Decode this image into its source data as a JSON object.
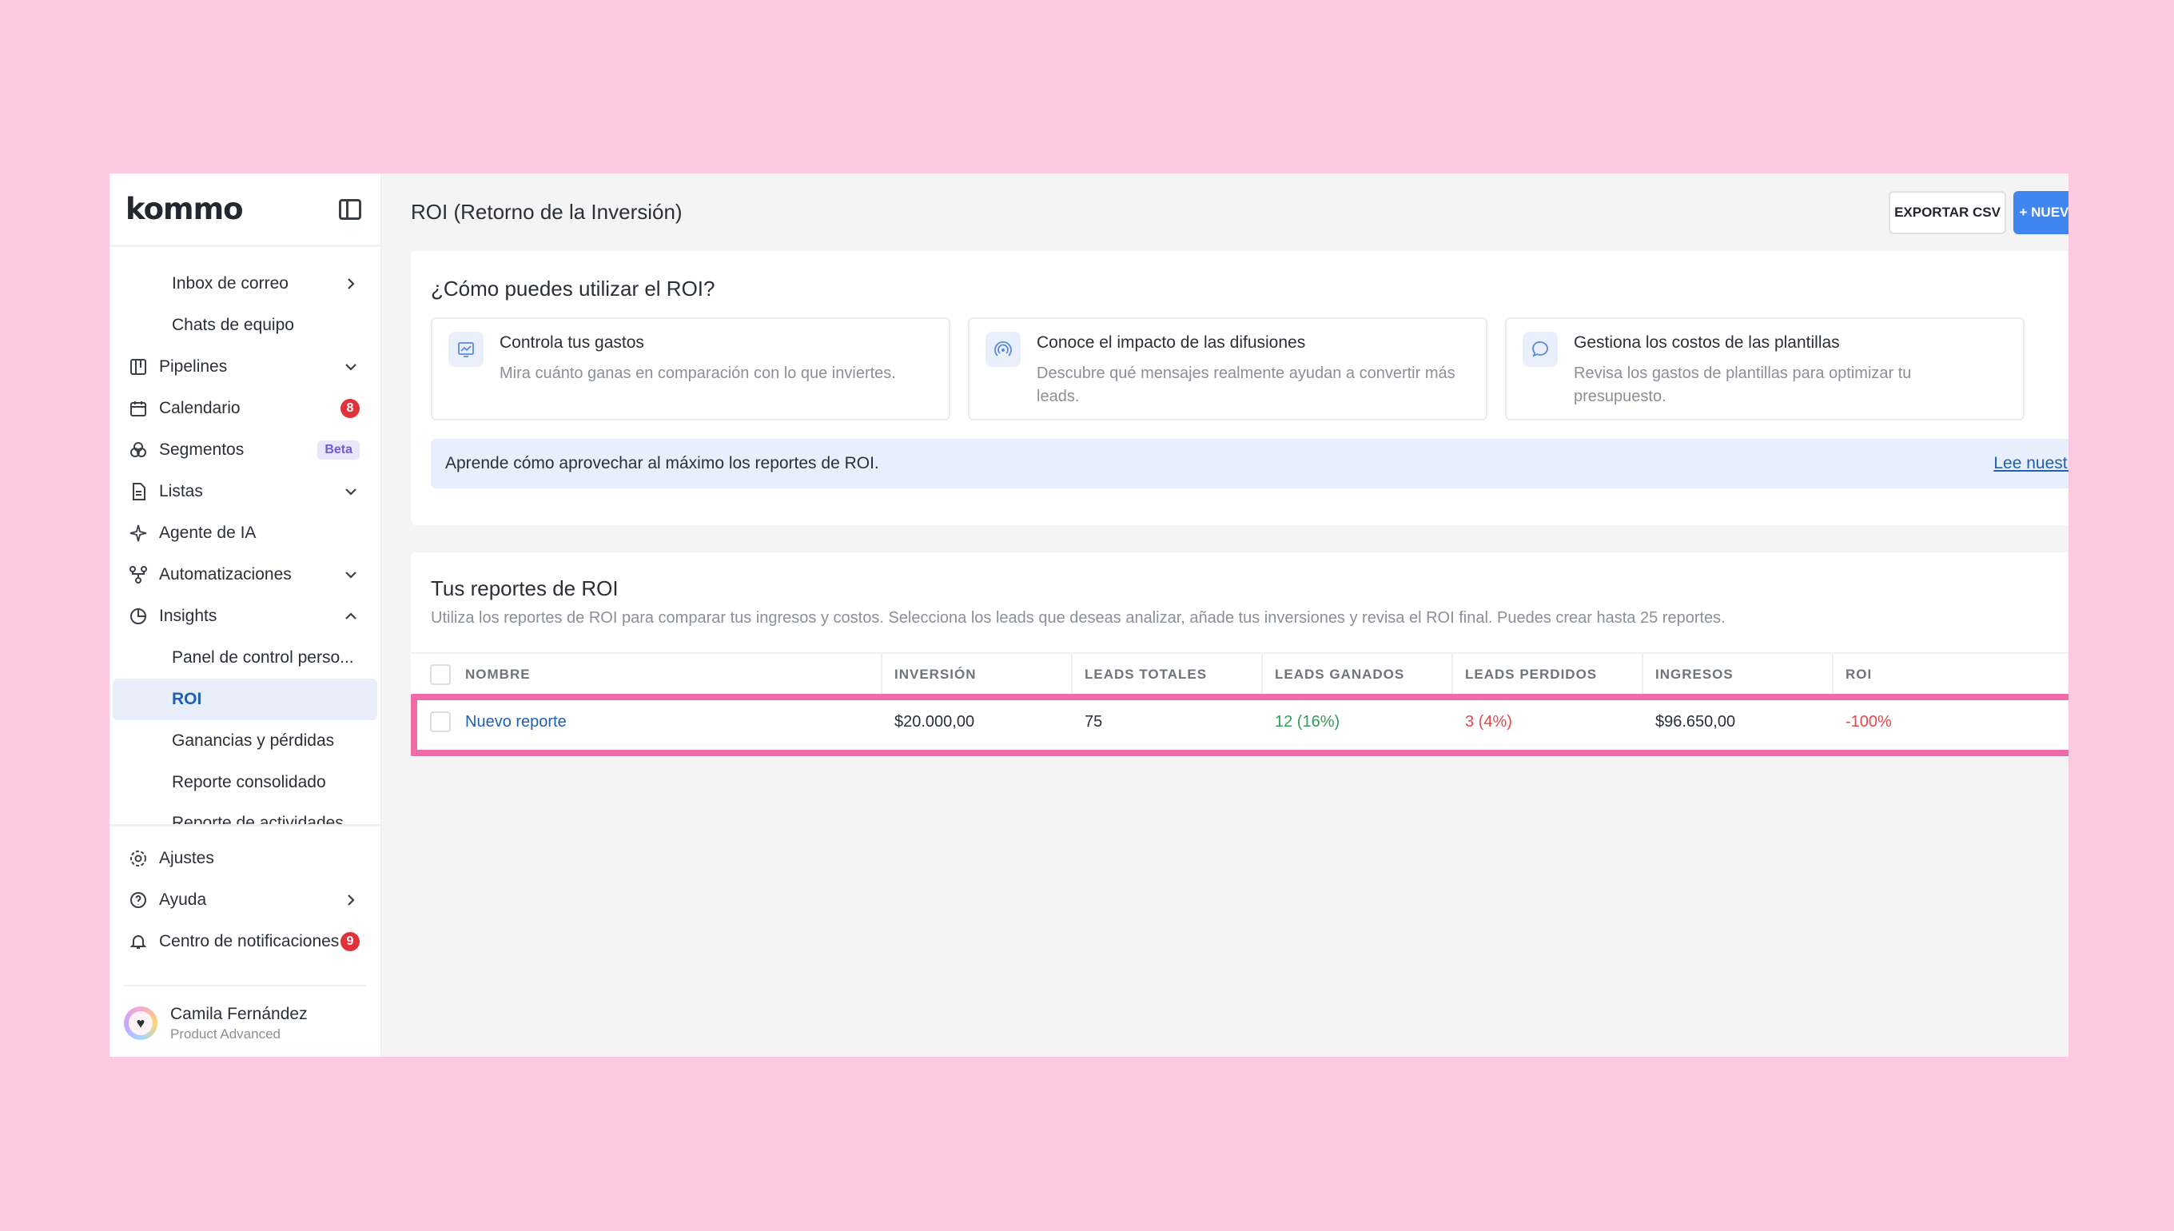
{
  "brand": {
    "logo_text": "kommo"
  },
  "sidebar": {
    "items": [
      {
        "label": "Inbox de correo",
        "icon": "",
        "trailing": "chevron-right-icon"
      },
      {
        "label": "Chats de equipo",
        "icon": "",
        "trailing": ""
      },
      {
        "label": "Pipelines",
        "icon": "pipelines-icon",
        "trailing": "chevron-down-icon"
      },
      {
        "label": "Calendario",
        "icon": "calendar-icon",
        "badge": "8"
      },
      {
        "label": "Segmentos",
        "icon": "segments-icon",
        "badge": "Beta"
      },
      {
        "label": "Listas",
        "icon": "list-icon",
        "trailing": "chevron-down-icon"
      },
      {
        "label": "Agente de IA",
        "icon": "sparkle-icon"
      },
      {
        "label": "Automatizaciones",
        "icon": "automation-icon",
        "trailing": "chevron-down-icon"
      },
      {
        "label": "Insights",
        "icon": "pie-chart-icon",
        "trailing": "chevron-up-icon"
      },
      {
        "label": "Panel de control perso..."
      },
      {
        "label": "ROI",
        "active": true
      },
      {
        "label": "Ganancias y pérdidas"
      },
      {
        "label": "Reporte consolidado"
      },
      {
        "label": "Reporte de actividades"
      }
    ],
    "bottom": [
      {
        "label": "Ajustes",
        "icon": "gear-icon"
      },
      {
        "label": "Ayuda",
        "icon": "help-icon",
        "trailing": "chevron-right-icon"
      },
      {
        "label": "Centro de notificaciones",
        "icon": "bell-icon",
        "badge": "9"
      }
    ],
    "user": {
      "name": "Camila Fernández",
      "role": "Product Advanced"
    }
  },
  "header": {
    "title": "ROI (Retorno de la Inversión)",
    "export_label": "EXPORTAR CSV",
    "new_label": "+ NUEVO REPORTE"
  },
  "howto": {
    "title": "¿Cómo puedes utilizar el ROI?",
    "features": [
      {
        "title": "Controla tus gastos",
        "desc": "Mira cuánto ganas en comparación con lo que inviertes.",
        "icon": "chart-icon"
      },
      {
        "title": "Conoce el impacto de las difusiones",
        "desc": "Descubre qué mensajes realmente ayudan a convertir más leads.",
        "icon": "broadcast-icon"
      },
      {
        "title": "Gestiona los costos de las plantillas",
        "desc": "Revisa los gastos de plantillas para optimizar tu presupuesto.",
        "icon": "chat-bubble-icon"
      }
    ],
    "guide_text": "Aprende cómo aprovechar al máximo los reportes de ROI.",
    "guide_link": "Lee nuestra guía"
  },
  "reports": {
    "title": "Tus reportes de ROI",
    "desc": "Utiliza los reportes de ROI para comparar tus ingresos y costos. Selecciona los leads que deseas analizar, añade tus inversiones y revisa el ROI final. Puedes crear hasta 25 reportes.",
    "columns": [
      "NOMBRE",
      "INVERSIÓN",
      "LEADS TOTALES",
      "LEADS GANADOS",
      "LEADS PERDIDOS",
      "INGRESOS",
      "ROI"
    ],
    "rows": [
      {
        "name": "Nuevo reporte",
        "investment": "$20.000,00",
        "leads_total": "75",
        "leads_won": "12 (16%)",
        "leads_lost": "3 (4%)",
        "revenue": "$96.650,00",
        "roi": "-100%"
      }
    ]
  },
  "colors": {
    "accent": "#3f86f0",
    "link": "#1f5fb3",
    "highlight": "#f06ba8",
    "background": "#fdc9e0"
  }
}
